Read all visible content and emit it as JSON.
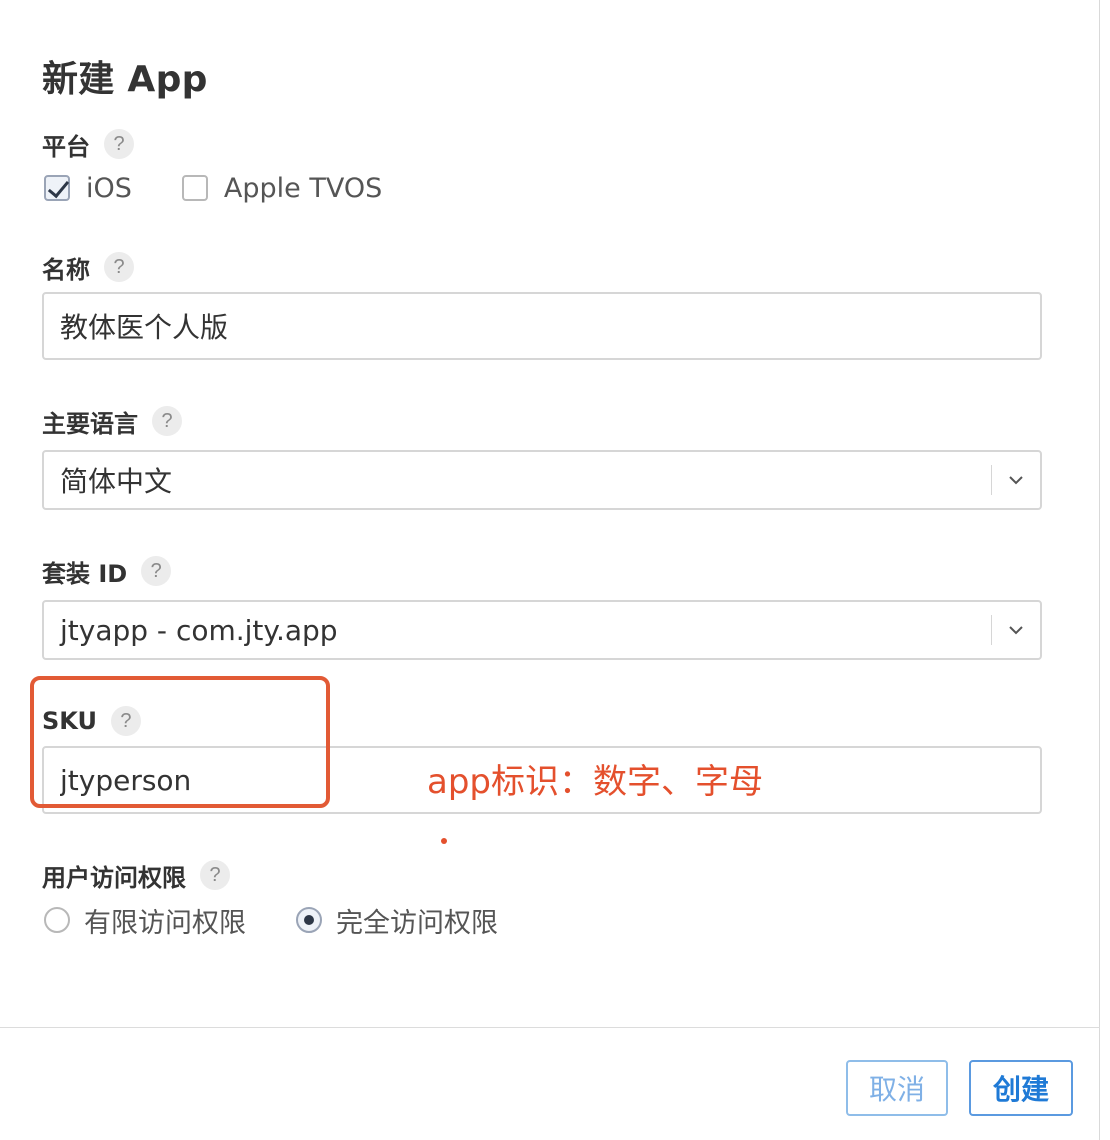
{
  "dialog": {
    "title": "新建 App"
  },
  "platform": {
    "label": "平台",
    "help": "?",
    "options": [
      {
        "label": "iOS",
        "checked": true
      },
      {
        "label": "Apple TVOS",
        "checked": false
      }
    ]
  },
  "name": {
    "label": "名称",
    "help": "?",
    "value": "教体医个人版"
  },
  "language": {
    "label": "主要语言",
    "help": "?",
    "value": "简体中文"
  },
  "bundle": {
    "label": "套装 ID",
    "help": "?",
    "value": "jtyapp - com.jty.app"
  },
  "sku": {
    "label": "SKU",
    "help": "?",
    "value": "jtyperson"
  },
  "annotation": {
    "text": "app标识：数字、字母",
    "color": "#e4502d"
  },
  "access": {
    "label": "用户访问权限",
    "help": "?",
    "options": [
      {
        "label": "有限访问权限",
        "selected": false
      },
      {
        "label": "完全访问权限",
        "selected": true
      }
    ]
  },
  "footer": {
    "cancel_label": "取消",
    "create_label": "创建"
  },
  "colors": {
    "accent": "#1f7ad6",
    "annotation": "#e4502d"
  }
}
